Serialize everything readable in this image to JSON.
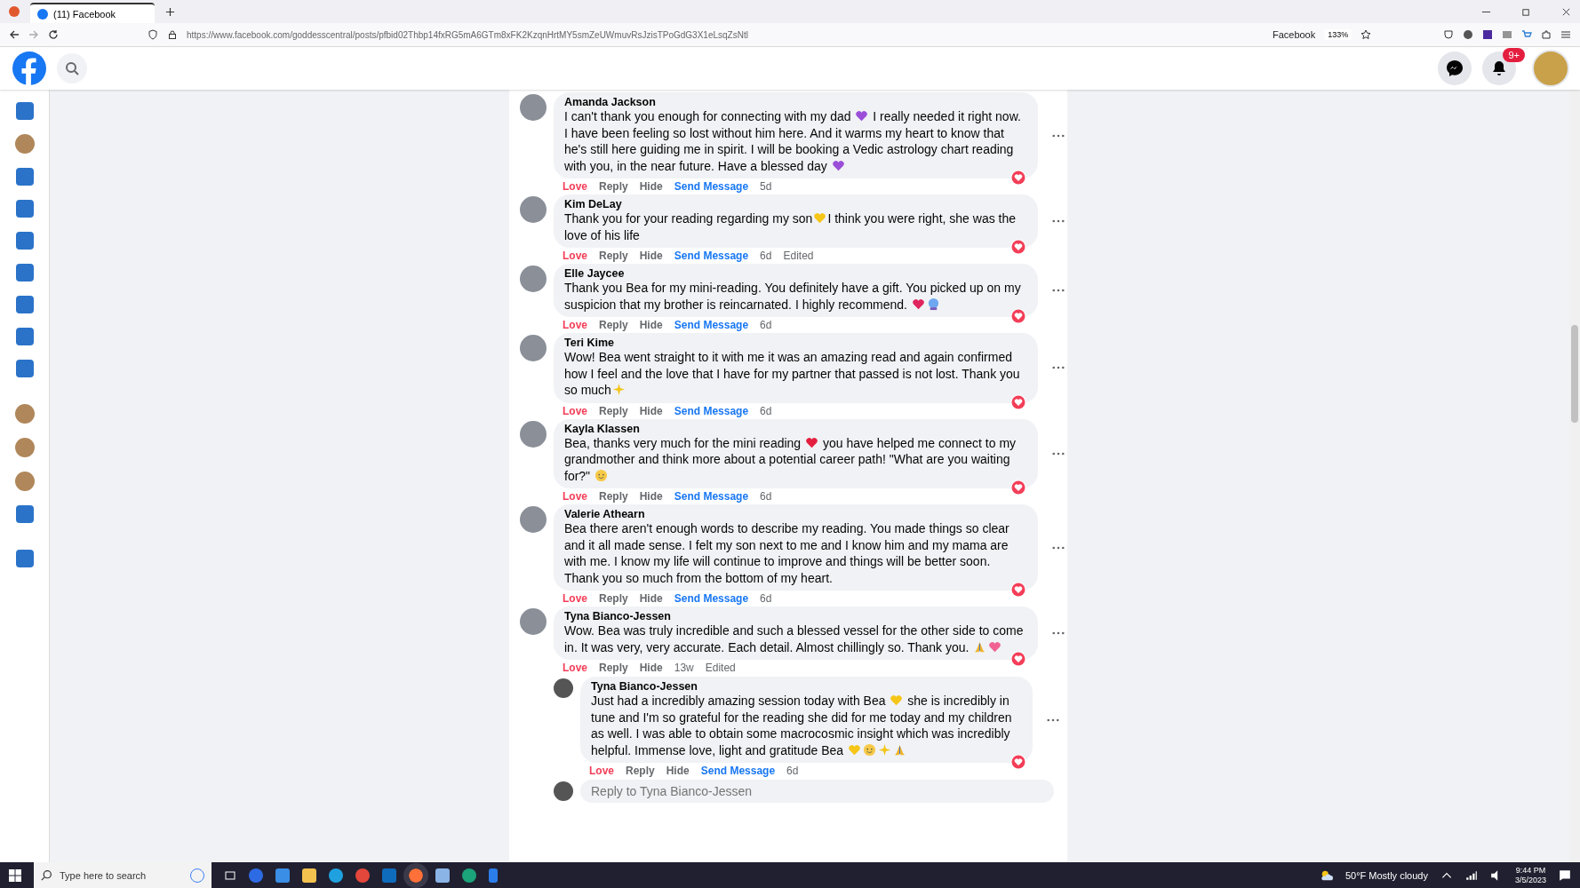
{
  "browser": {
    "tab_title": "(11) Facebook",
    "url": "https://www.facebook.com/goddesscentral/posts/pfbid02Thbp14fxRG5mA6GTm8xFK2KzqnHrtMY5smZeUWmuvRsJzisTPoGdG3X1eLsqZsNtl",
    "bookmark": "Facebook",
    "zoom": "133%"
  },
  "header": {
    "notification_badge": "9+"
  },
  "comments": [
    {
      "author": "Amanda Jackson",
      "body": [
        {
          "kind": "text",
          "text": "I can't thank you enough for connecting with my dad "
        },
        {
          "kind": "heart",
          "color": "#9b4fd8"
        },
        {
          "kind": "text",
          "text": " I really needed it right now. I have been feeling so lost without him here. And it warms my heart to know that he's still here guiding me in spirit. I will be booking a Vedic astrology chart reading with you, in the near future. Have a blessed day "
        },
        {
          "kind": "heart",
          "color": "#9b4fd8"
        }
      ],
      "love": "Love",
      "reply": "Reply",
      "hide": "Hide",
      "message": "Send Message",
      "time": "5d"
    },
    {
      "author": "Kim DeLay",
      "body": [
        {
          "kind": "text",
          "text": "Thank you for your reading regarding my son"
        },
        {
          "kind": "heart",
          "color": "#f5c518"
        },
        {
          "kind": "text",
          "text": "I think you were right, she was the love of his life"
        }
      ],
      "love": "Love",
      "reply": "Reply",
      "hide": "Hide",
      "message": "Send Message",
      "time": "6d",
      "edited": "Edited"
    },
    {
      "author": "Elle Jaycee",
      "body": [
        {
          "kind": "text",
          "text": "Thank you Bea for my mini-reading. You definitely have a gift. You picked up on my suspicion that my brother is reincarnated. I highly recommend. "
        },
        {
          "kind": "heart",
          "color": "#e0245e"
        },
        {
          "kind": "globe"
        }
      ],
      "love": "Love",
      "reply": "Reply",
      "hide": "Hide",
      "message": "Send Message",
      "time": "6d"
    },
    {
      "author": "Teri Kime",
      "body": [
        {
          "kind": "text",
          "text": "Wow! Bea went straight to it with me it was an amazing read and again confirmed how I feel and the love that I have for my partner that passed is not lost. Thank you so much"
        },
        {
          "kind": "sparkle"
        }
      ],
      "love": "Love",
      "reply": "Reply",
      "hide": "Hide",
      "message": "Send Message",
      "time": "6d"
    },
    {
      "author": "Kayla Klassen",
      "body": [
        {
          "kind": "text",
          "text": "Bea, thanks very much for the mini reading "
        },
        {
          "kind": "heart",
          "color": "#e41e3f"
        },
        {
          "kind": "text",
          "text": " you have helped me connect to my grandmother and think more about a potential career path! \"What are you waiting for?\" "
        },
        {
          "kind": "face"
        }
      ],
      "love": "Love",
      "reply": "Reply",
      "hide": "Hide",
      "message": "Send Message",
      "time": "6d"
    },
    {
      "author": "Valerie Athearn",
      "body": [
        {
          "kind": "text",
          "text": "Bea there aren't enough words to describe my reading. You made things so clear and it all made sense. I felt my son next to me and I know him and my mama are with me. I know my life will continue to improve and things will be better soon. Thank you so much from the bottom of my heart."
        }
      ],
      "love": "Love",
      "reply": "Reply",
      "hide": "Hide",
      "message": "Send Message",
      "time": "6d"
    },
    {
      "author": "Tyna Bianco-Jessen",
      "body": [
        {
          "kind": "text",
          "text": "Wow. Bea was truly incredible and such a blessed vessel for the other side to come in. It was very, very accurate. Each detail. Almost chillingly so. Thank you. "
        },
        {
          "kind": "hands"
        },
        {
          "kind": "heart",
          "color": "#f06292"
        }
      ],
      "love": "Love",
      "reply": "Reply",
      "hide": "Hide",
      "time": "13w",
      "edited": "Edited",
      "replies": [
        {
          "author": "Tyna Bianco-Jessen",
          "body": [
            {
              "kind": "text",
              "text": "Just had a incredibly amazing session today with Bea "
            },
            {
              "kind": "heart",
              "color": "#f5c518"
            },
            {
              "kind": "text",
              "text": " she is incredibly in tune and I'm so grateful for the reading she did for me today and my children as well. I was able to obtain some macrocosmic insight which was incredibly helpful. Immense love, light and gratitude Bea "
            },
            {
              "kind": "heart",
              "color": "#f5c518"
            },
            {
              "kind": "face"
            },
            {
              "kind": "sparkle"
            },
            {
              "kind": "hands"
            }
          ],
          "love": "Love",
          "reply": "Reply",
          "hide": "Hide",
          "message": "Send Message",
          "time": "6d"
        }
      ]
    }
  ],
  "reply_box": {
    "placeholder": "Reply to Tyna Bianco-Jessen"
  },
  "taskbar": {
    "search_placeholder": "Type here to search",
    "weather": "50°F Mostly cloudy",
    "time": "9:44 PM",
    "date": "3/5/2023"
  }
}
